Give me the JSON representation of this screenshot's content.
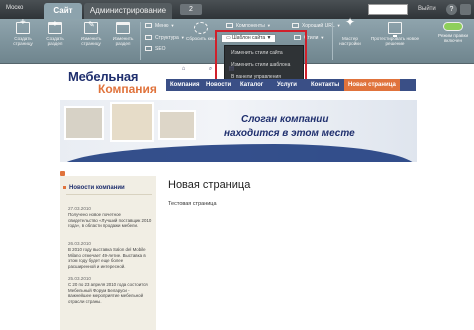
{
  "admin_bar": {
    "brand": "Москo",
    "tab_site": "Сайт",
    "tab_admin": "Администрирование",
    "notifications_count": "2",
    "logout": "Выйти",
    "help": "?"
  },
  "toolbar": {
    "create_page": "Создать страницу",
    "create_section": "Создать раздел",
    "edit_page": "Изменить страницу",
    "edit_section": "Изменить раздел",
    "clear_cache": "Сбросить кеш",
    "menu": "Меню",
    "structure": "Структура",
    "seo": "SEO",
    "components": "Компоненты",
    "template_edit": "Шаблон сайта",
    "stylesheets": "Стили",
    "cache_url": "Хороший URL",
    "wizard": "Мастер настройки",
    "preview_solution": "Протестировать новое решение",
    "edit_mode": "Режим правки включен"
  },
  "dropdown": {
    "items": [
      "Изменить стили сайта",
      "Изменить стили шаблона",
      "В панели управления"
    ]
  },
  "site": {
    "logo_line1": "Мебельная",
    "logo_line2": "Компания",
    "nav": [
      "Компания",
      "Новости",
      "Каталог",
      "Услуги",
      "Контакты",
      "Новая страница"
    ],
    "slogan_line1": "Слоган компании",
    "slogan_line2": "находится в этом месте"
  },
  "sidebar": {
    "title": "Новости компании",
    "news": [
      {
        "date": "27.03.2010",
        "text": "Получено новое почетное свидетельство «Лучший поставщик 2010 года», в области продажи мебели."
      },
      {
        "date": "26.03.2010",
        "text": "В 2010 году выставка Salon del Mobile Milano отмечает 49-летие. Выставка в этом году будет еще более расширенной и интересной."
      },
      {
        "date": "25.03.2010",
        "text": "С 20 по 23 апреля 2010 года состоится Мебельный Форум Беларуси - важнейшее мероприятие мебельной отрасли страны."
      }
    ]
  },
  "main": {
    "title": "Новая страница",
    "text": "Тестовая страница"
  },
  "colors": {
    "admin_bg": "#2f3438",
    "toolbar_bg": "#7f959e",
    "nav_bg": "#3a4f86",
    "accent": "#e0733c",
    "highlight_border": "#d0202b"
  }
}
